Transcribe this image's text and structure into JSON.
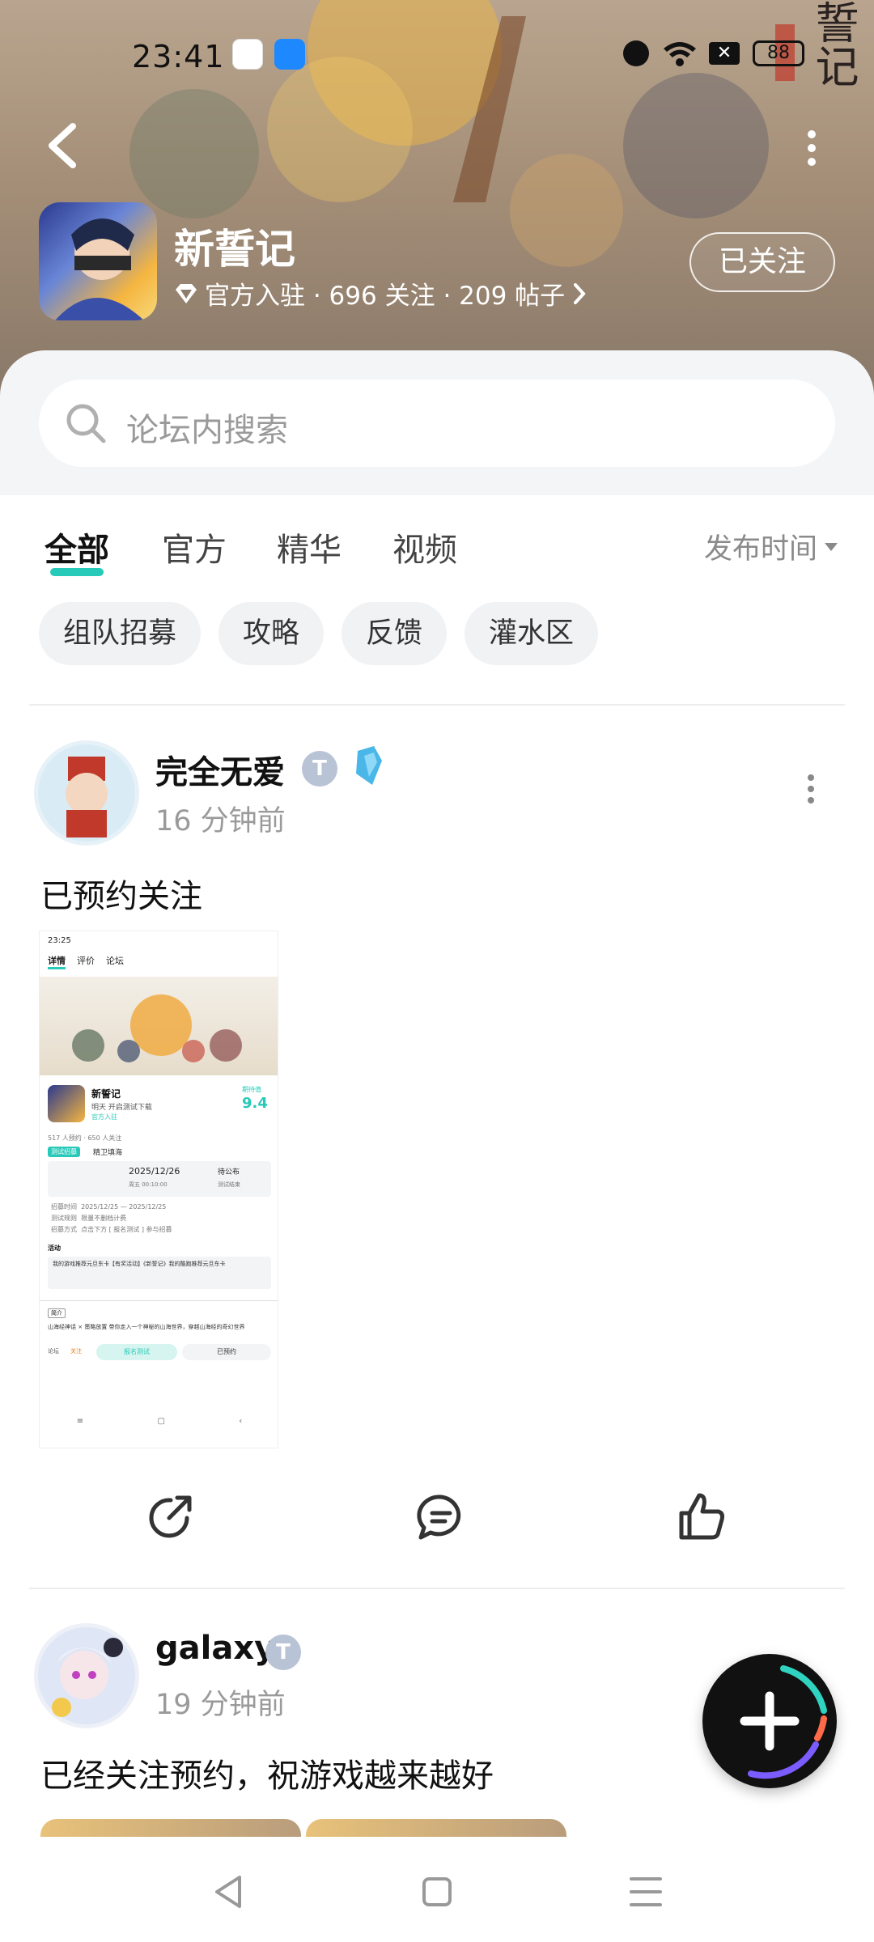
{
  "status_bar": {
    "time": "23:41",
    "battery": "88",
    "x_label": "✕"
  },
  "header": {
    "game_name": "新誓记",
    "meta": "官方入驻 · 696 关注 · 209 帖子",
    "follow_label": "已关注",
    "banner_calligraphy": "誓记"
  },
  "search": {
    "placeholder": "论坛内搜索"
  },
  "tabs": [
    {
      "label": "全部"
    },
    {
      "label": "官方"
    },
    {
      "label": "精华"
    },
    {
      "label": "视频"
    }
  ],
  "sort_label": "发布时间",
  "chips": [
    {
      "label": "组队招募"
    },
    {
      "label": "攻略"
    },
    {
      "label": "反馈"
    },
    {
      "label": "灌水区"
    }
  ],
  "posts": [
    {
      "username": "完全无爱",
      "time": "16 分钟前",
      "text": "已预约关注",
      "badge": "T",
      "screenshot": {
        "time": "23:25",
        "tabs": [
          "详情",
          "评价",
          "论坛"
        ],
        "game_name": "新誓记",
        "game_sub": "明天 开启测试下载",
        "official": "官方入驻",
        "score_label": "期待值",
        "score": "9.4",
        "stats": "517 人预约 · 650 人关注",
        "test_tag": "测试招募",
        "test_name": "精卫填海",
        "date": "2025/12/26",
        "date_sub": "周五 00:10:00",
        "pending": "待公布",
        "pending_sub": "测试结束",
        "rows": [
          [
            "招募时间",
            "2025/12/25 — 2025/12/25"
          ],
          [
            "测试规则",
            "限量不删档计费"
          ],
          [
            "招募方式",
            "点击下方 [ 报名测试 ] 参与招募"
          ]
        ],
        "activity_label": "活动",
        "activity_text": "我的游戏推荐元旦东卡【有奖活动】《新誓记》我的酷跑推荐元旦东卡",
        "intro_tag": "简介",
        "intro_text": "山海经神话 × 策略放置 带你走入一个神秘的山海世界，穿越山海经的奇幻世界",
        "btn_left": "报名测试",
        "btn_right": "已预约",
        "bottom_left": "论坛",
        "bottom_mid": "关注"
      }
    },
    {
      "username": "galaxy",
      "time": "19 分钟前",
      "text": "已经关注预约，祝游戏越来越好",
      "badge": "T"
    }
  ],
  "icons": {
    "back": "chevron-left-icon",
    "more": "more-vertical-icon",
    "search": "search-icon",
    "share": "share-icon",
    "comment": "comment-icon",
    "like": "thumbs-up-icon",
    "fab": "plus-icon"
  },
  "colors": {
    "accent": "#27c9b8",
    "fab": "#111111"
  }
}
